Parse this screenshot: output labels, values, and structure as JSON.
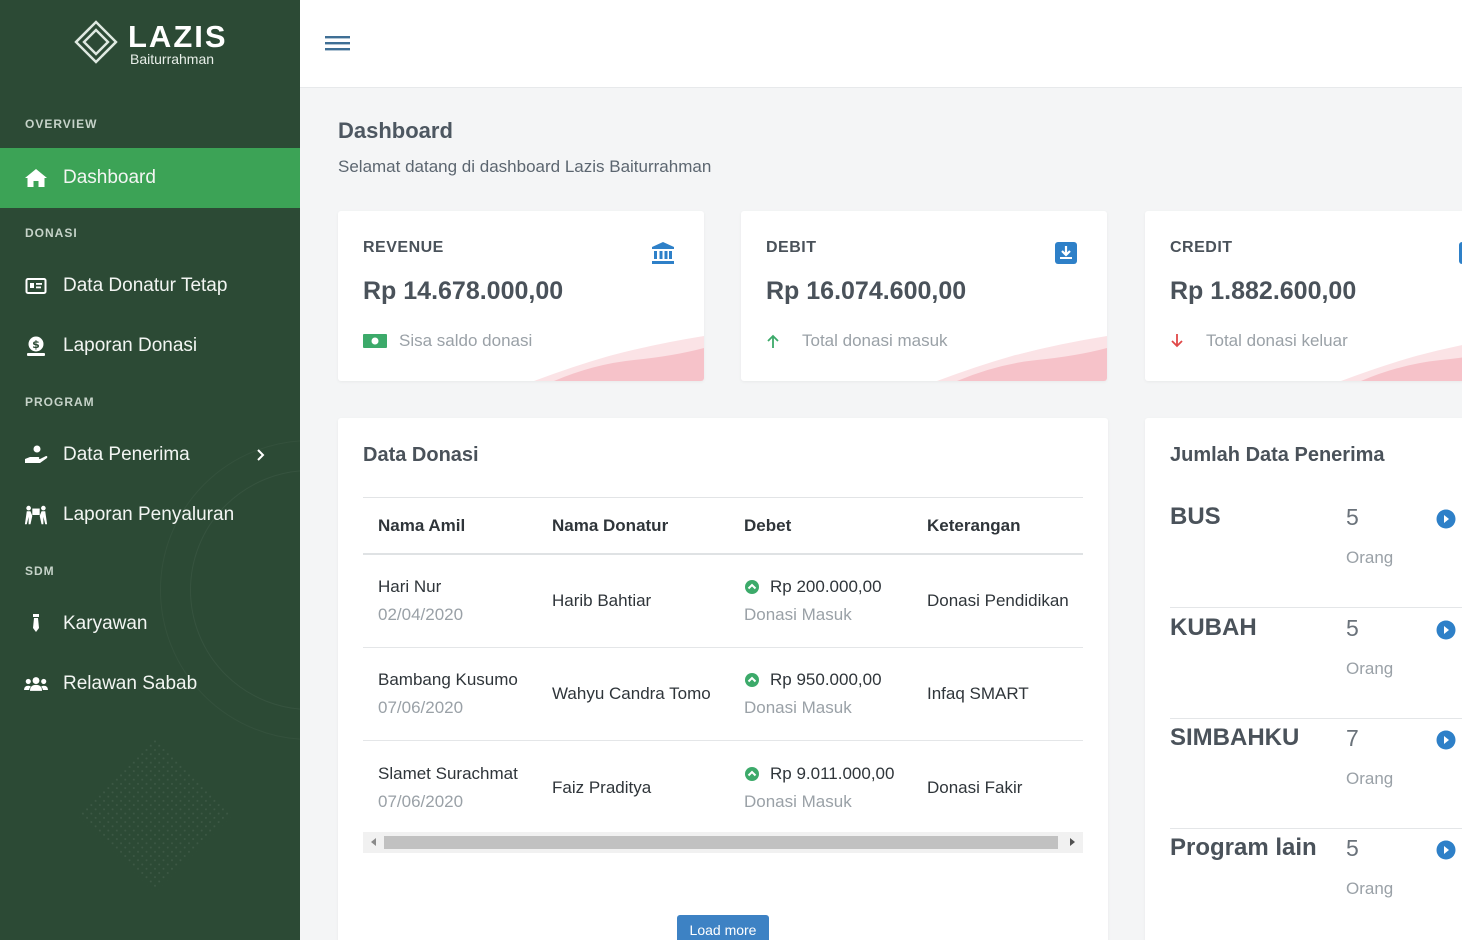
{
  "brand": {
    "title": "LAZIS",
    "subtitle": "Baiturrahman"
  },
  "sidebar": {
    "sections": {
      "overview": "OVERVIEW",
      "donasi": "DONASI",
      "program": "PROGRAM",
      "sdm": "SDM"
    },
    "items": {
      "dashboard": "Dashboard",
      "donatur": "Data Donatur Tetap",
      "laporan_donasi": "Laporan Donasi",
      "penerima": "Data Penerima",
      "penyaluran": "Laporan Penyaluran",
      "karyawan": "Karyawan",
      "relawan": "Relawan Sabab"
    }
  },
  "header": {
    "title": "Dashboard",
    "subtitle": "Selamat datang di dashboard Lazis Baiturrahman"
  },
  "stats": {
    "revenue": {
      "label": "REVENUE",
      "value": "Rp 14.678.000,00",
      "note": "Sisa saldo donasi",
      "icon": "bank-icon"
    },
    "debit": {
      "label": "DEBIT",
      "value": "Rp 16.074.600,00",
      "note": "Total donasi masuk",
      "icon": "download-box-icon"
    },
    "credit": {
      "label": "CREDIT",
      "value": "Rp 1.882.600,00",
      "note": "Total donasi keluar",
      "icon": "upload-box-icon"
    }
  },
  "donasi": {
    "title": "Data Donasi",
    "columns": [
      "Nama Amil",
      "Nama Donatur",
      "Debet",
      "Keterangan"
    ],
    "rows": [
      {
        "amil": "Hari Nur",
        "date": "02/04/2020",
        "donatur": "Harib Bahtiar",
        "amount": "Rp 200.000,00",
        "status": "Donasi Masuk",
        "keterangan": "Donasi Pendidikan"
      },
      {
        "amil": "Bambang Kusumo",
        "date": "07/06/2020",
        "donatur": "Wahyu Candra Tomo",
        "amount": "Rp 950.000,00",
        "status": "Donasi Masuk",
        "keterangan": "Infaq SMART"
      },
      {
        "amil": "Slamet Surachmat",
        "date": "07/06/2020",
        "donatur": "Faiz Praditya",
        "amount": "Rp 9.011.000,00",
        "status": "Donasi Masuk",
        "keterangan": "Donasi Fakir"
      }
    ],
    "load_more": "Load more"
  },
  "penerima": {
    "title": "Jumlah Data Penerima",
    "rows": [
      {
        "name": "BUS",
        "count": "5",
        "unit": "Orang"
      },
      {
        "name": "KUBAH",
        "count": "5",
        "unit": "Orang"
      },
      {
        "name": "SIMBAHKU",
        "count": "7",
        "unit": "Orang"
      },
      {
        "name": "Program lain",
        "count": "5",
        "unit": "Orang"
      }
    ]
  },
  "colors": {
    "sidebar": "#2c4a35",
    "active": "#3ca356",
    "accent_blue": "#2e80c8",
    "success": "#3caa6a",
    "danger": "#e04848"
  }
}
